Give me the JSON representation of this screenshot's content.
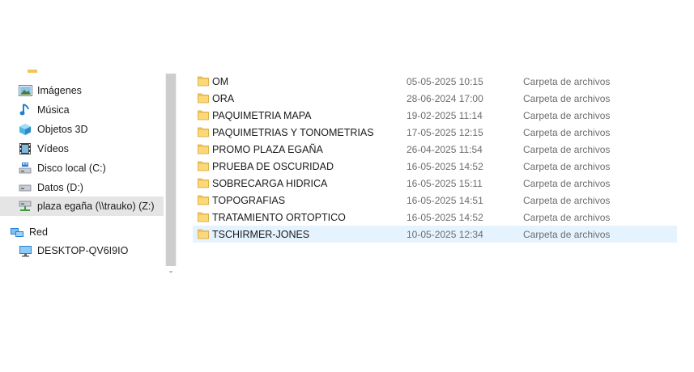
{
  "nav": {
    "items": [
      {
        "label": "Imágenes",
        "icon": "pictures-icon"
      },
      {
        "label": "Música",
        "icon": "music-icon"
      },
      {
        "label": "Objetos 3D",
        "icon": "3d-objects-icon"
      },
      {
        "label": "Vídeos",
        "icon": "videos-icon"
      },
      {
        "label": "Disco local (C:)",
        "icon": "local-disk-icon"
      },
      {
        "label": "Datos (D:)",
        "icon": "drive-icon"
      },
      {
        "label": "plaza egaña (\\\\trauko) (Z:)",
        "icon": "network-drive-icon",
        "selected": true
      },
      {
        "label": "Red",
        "icon": "network-icon"
      },
      {
        "label": "DESKTOP-QV6I9IO",
        "icon": "computer-icon"
      }
    ]
  },
  "files": {
    "rows": [
      {
        "name": "OM",
        "date": "05-05-2025 10:15",
        "type": "Carpeta de archivos"
      },
      {
        "name": "ORA",
        "date": "28-06-2024 17:00",
        "type": "Carpeta de archivos"
      },
      {
        "name": "PAQUIMETRIA MAPA",
        "date": "19-02-2025 11:14",
        "type": "Carpeta de archivos"
      },
      {
        "name": "PAQUIMETRIAS Y TONOMETRIAS",
        "date": "17-05-2025 12:15",
        "type": "Carpeta de archivos"
      },
      {
        "name": "PROMO PLAZA EGAÑA",
        "date": "26-04-2025 11:54",
        "type": "Carpeta de archivos"
      },
      {
        "name": "PRUEBA DE OSCURIDAD",
        "date": "16-05-2025 14:52",
        "type": "Carpeta de archivos"
      },
      {
        "name": "SOBRECARGA HIDRICA",
        "date": "16-05-2025 15:11",
        "type": "Carpeta de archivos"
      },
      {
        "name": "TOPOGRAFIAS",
        "date": "16-05-2025 14:51",
        "type": "Carpeta de archivos"
      },
      {
        "name": "TRATAMIENTO ORTOPTICO",
        "date": "16-05-2025 14:52",
        "type": "Carpeta de archivos"
      },
      {
        "name": "TSCHIRMER-JONES",
        "date": "10-05-2025 12:34",
        "type": "Carpeta de archivos",
        "selected": true
      }
    ]
  },
  "colors": {
    "folder": "#f2c55c",
    "row_selected": "#e5f3ff",
    "nav_selected": "#e5e5e5"
  }
}
